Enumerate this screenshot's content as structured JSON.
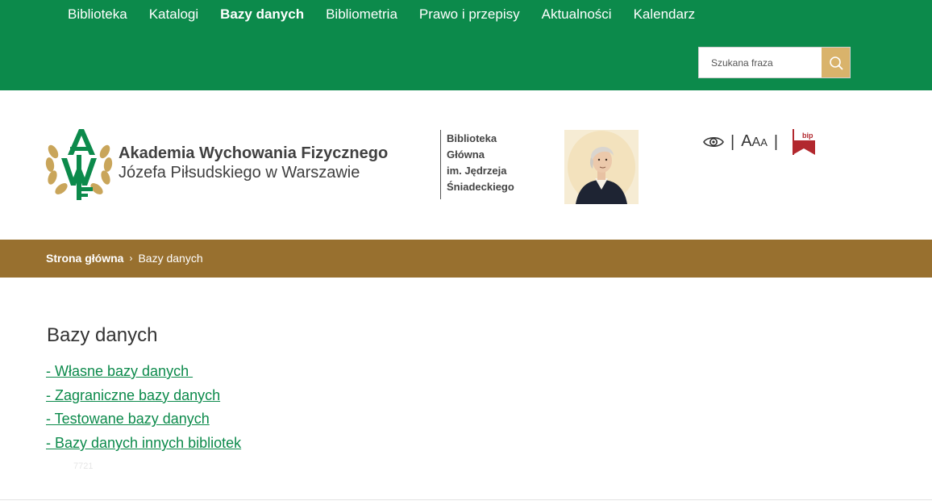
{
  "nav": {
    "items": [
      {
        "label": "Biblioteka",
        "active": false
      },
      {
        "label": "Katalogi",
        "active": false
      },
      {
        "label": "Bazy danych",
        "active": true
      },
      {
        "label": "Bibliometria",
        "active": false
      },
      {
        "label": "Prawo i przepisy",
        "active": false
      },
      {
        "label": "Aktualności",
        "active": false
      },
      {
        "label": "Kalendarz",
        "active": false
      }
    ]
  },
  "search": {
    "placeholder": "Szukana fraza",
    "icon": "search-icon"
  },
  "header": {
    "logo_letters": "AWF",
    "org_line1": "Akademia Wychowania Fizycznego",
    "org_line2": "Józefa Piłsudskiego w Warszawie",
    "library_lines": [
      "Biblioteka",
      "Główna",
      "im. Jędrzeja",
      "Śniadeckiego"
    ],
    "portrait": "portrait-image",
    "tools": {
      "contrast_icon": "eye-icon",
      "separator": "|",
      "font_size_big": "A",
      "font_size_mid": "A",
      "font_size_small": "A",
      "bip_label": "bip"
    }
  },
  "breadcrumb": {
    "home": "Strona główna",
    "separator": "›",
    "current": "Bazy danych"
  },
  "main": {
    "title": "Bazy danych",
    "links": [
      "- Własne bazy danych ",
      "- Zagraniczne bazy danych",
      "- Testowane bazy danych",
      "- Bazy danych innych bibliotek"
    ],
    "faint_text": "7721"
  },
  "colors": {
    "green": "#0c8a4b",
    "gold": "#98702f",
    "search_button": "#d9b36b",
    "bip_red": "#b2282e"
  }
}
